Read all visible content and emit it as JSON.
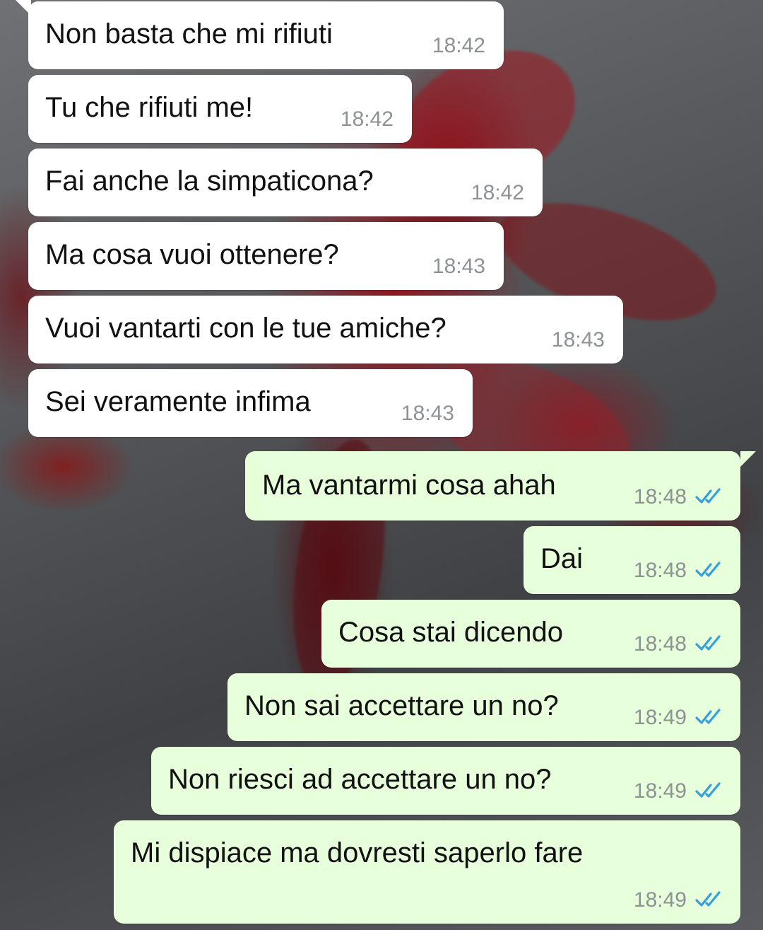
{
  "colors": {
    "incoming_bubble": "#ffffff",
    "outgoing_bubble": "#e7ffdb",
    "timestamp": "#8d9295",
    "read_ticks": "#34a0e0"
  },
  "icons": {
    "read_receipt": "double-check-icon"
  },
  "messages": [
    {
      "direction": "incoming",
      "text": "Non basta che mi rifiuti",
      "time": "18:42"
    },
    {
      "direction": "incoming",
      "text": "Tu che rifiuti me!",
      "time": "18:42"
    },
    {
      "direction": "incoming",
      "text": "Fai anche la simpaticona?",
      "time": "18:42"
    },
    {
      "direction": "incoming",
      "text": "Ma cosa vuoi ottenere?",
      "time": "18:43"
    },
    {
      "direction": "incoming",
      "text": "Vuoi vantarti con le tue amiche?",
      "time": "18:43"
    },
    {
      "direction": "incoming",
      "text": "Sei veramente infima",
      "time": "18:43"
    },
    {
      "direction": "outgoing",
      "text": "Ma vantarmi cosa ahah",
      "time": "18:48",
      "status": "read"
    },
    {
      "direction": "outgoing",
      "text": "Dai",
      "time": "18:48",
      "status": "read"
    },
    {
      "direction": "outgoing",
      "text": "Cosa stai dicendo",
      "time": "18:48",
      "status": "read"
    },
    {
      "direction": "outgoing",
      "text": "Non sai accettare un no?",
      "time": "18:49",
      "status": "read"
    },
    {
      "direction": "outgoing",
      "text": "Non riesci ad accettare un no?",
      "time": "18:49",
      "status": "read"
    },
    {
      "direction": "outgoing",
      "text": "Mi dispiace ma dovresti saperlo fare",
      "time": "18:49",
      "status": "read"
    }
  ]
}
